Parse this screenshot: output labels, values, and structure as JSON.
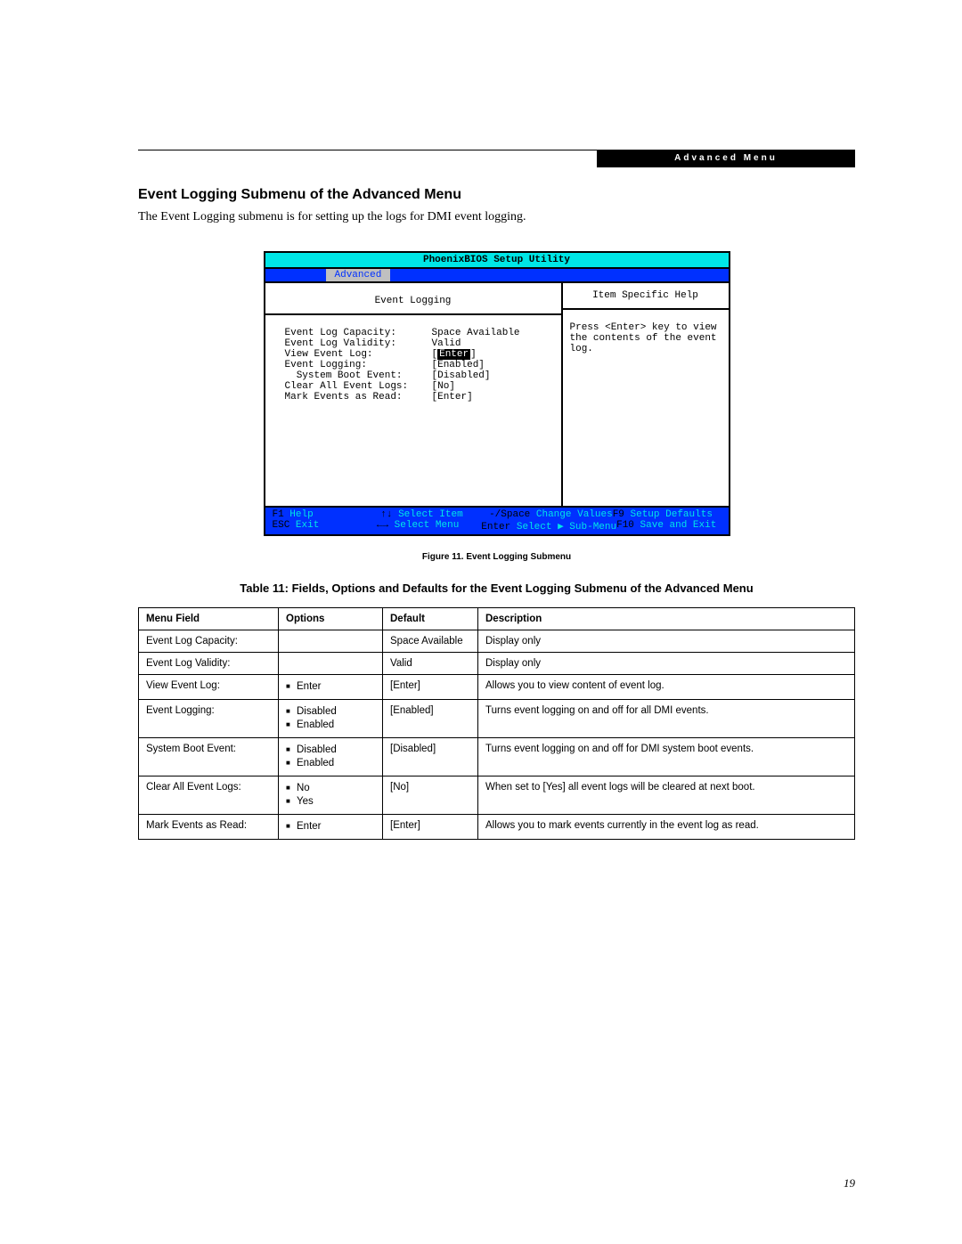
{
  "header_bar": "Advanced Menu",
  "section_title": "Event Logging Submenu of the Advanced Menu",
  "intro": "The Event Logging submenu is for setting up the logs for DMI event logging.",
  "bios": {
    "utility_title": "PhoenixBIOS Setup Utility",
    "active_tab": "Advanced",
    "left_title": "Event Logging",
    "rows": [
      {
        "label": "Event Log Capacity:",
        "value": "Space Available",
        "hi": false,
        "indent": 0
      },
      {
        "label": "Event Log Validity:",
        "value": "Valid",
        "hi": false,
        "indent": 0
      },
      {
        "label": "",
        "value": "",
        "hi": false,
        "indent": 0
      },
      {
        "label": "View Event Log:",
        "value": "[Enter]",
        "hi": true,
        "indent": 0
      },
      {
        "label": "",
        "value": "",
        "hi": false,
        "indent": 0
      },
      {
        "label": "Event Logging:",
        "value": "[Enabled]",
        "hi": false,
        "indent": 0
      },
      {
        "label": "  System Boot Event:",
        "value": "[Disabled]",
        "hi": false,
        "indent": 1
      },
      {
        "label": "",
        "value": "",
        "hi": false,
        "indent": 0
      },
      {
        "label": "Clear All Event Logs:",
        "value": "[No]",
        "hi": false,
        "indent": 0
      },
      {
        "label": "",
        "value": "",
        "hi": false,
        "indent": 0
      },
      {
        "label": "Mark Events as Read:",
        "value": "[Enter]",
        "hi": false,
        "indent": 0
      }
    ],
    "right_title": "Item Specific Help",
    "help_text": "Press <Enter> key to view the contents of the event log.",
    "footer": {
      "row1": {
        "c1k": "F1",
        "c1v": " Help",
        "c2k": "↑↓",
        "c2v": " Select Item",
        "c3k": "-/Space",
        "c3v": " Change Values",
        "c4k": "F9",
        "c4v": " Setup Defaults"
      },
      "row2": {
        "c1k": "ESC",
        "c1v": " Exit",
        "c2k": "←→",
        "c2v": " Select Menu",
        "c3k": "Enter",
        "c3v": " Select ▶ Sub-Menu",
        "c4k": "F10",
        "c4v": " Save and Exit"
      }
    }
  },
  "figure_caption": "Figure 11.   Event Logging Submenu",
  "table_title": "Table 11: Fields, Options and Defaults for the Event Logging Submenu of the Advanced Menu",
  "table": {
    "headers": [
      "Menu Field",
      "Options",
      "Default",
      "Description"
    ],
    "rows": [
      {
        "field": "Event Log Capacity:",
        "options": [],
        "default": "Space Available",
        "desc": "Display only"
      },
      {
        "field": "Event Log Validity:",
        "options": [],
        "default": "Valid",
        "desc": "Display only"
      },
      {
        "field": "View Event Log:",
        "options": [
          "Enter"
        ],
        "default": "[Enter]",
        "desc": "Allows you to view content of event log."
      },
      {
        "field": "Event Logging:",
        "options": [
          "Disabled",
          "Enabled"
        ],
        "default": "[Enabled]",
        "desc": "Turns event logging on and off for all DMI events."
      },
      {
        "field": "System Boot Event:",
        "options": [
          "Disabled",
          "Enabled"
        ],
        "default": "[Disabled]",
        "desc": "Turns event logging on and off for DMI system boot events."
      },
      {
        "field": "Clear All Event Logs:",
        "options": [
          "No",
          "Yes"
        ],
        "default": "[No]",
        "desc": "When set to [Yes] all event logs will be cleared at next boot."
      },
      {
        "field": "Mark Events as Read:",
        "options": [
          "Enter"
        ],
        "default": "[Enter]",
        "desc": "Allows you to mark events currently in the event log as read."
      }
    ]
  },
  "page_number": "19"
}
